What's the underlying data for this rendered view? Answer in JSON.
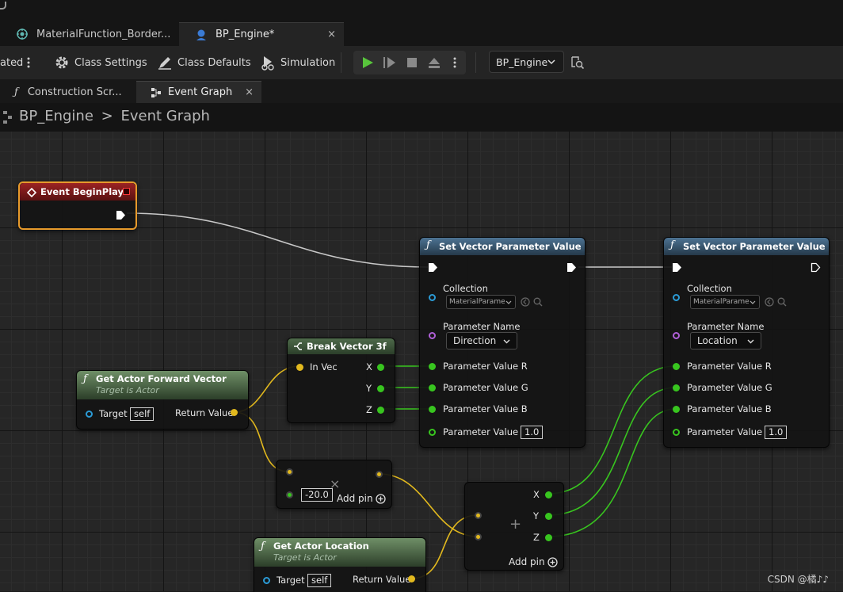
{
  "doc_tabs": [
    {
      "label": "MaterialFunction_Border..."
    },
    {
      "label": "BP_Engine*",
      "close": "×"
    }
  ],
  "toolbar": {
    "cut_text": "ated",
    "class_settings": "Class Settings",
    "class_defaults": "Class Defaults",
    "simulation": "Simulation",
    "blueprint_select": "BP_Engine"
  },
  "graph_tabs": [
    {
      "label": "Construction Scr..."
    },
    {
      "label": "Event Graph",
      "close": "×"
    }
  ],
  "breadcrumb": {
    "root": "BP_Engine",
    "sep": ">",
    "current": "Event Graph"
  },
  "nodes": {
    "event_begin_play": {
      "title": "Event BeginPlay"
    },
    "set_vec_1": {
      "title": "Set Vector Parameter Value",
      "collection_label": "Collection",
      "collection_value": "MaterialParame",
      "param_name_label": "Parameter Name",
      "param_name_value": "Direction",
      "r": "Parameter Value R",
      "g": "Parameter Value G",
      "b": "Parameter Value B",
      "a": "Parameter Value A",
      "a_value": "1.0"
    },
    "set_vec_2": {
      "title": "Set Vector Parameter Value",
      "collection_label": "Collection",
      "collection_value": "MaterialParame",
      "param_name_label": "Parameter Name",
      "param_name_value": "Location",
      "r": "Parameter Value R",
      "g": "Parameter Value G",
      "b": "Parameter Value B",
      "a": "Parameter Value A",
      "a_value": "1.0"
    },
    "break_vector": {
      "title": "Break Vector 3f",
      "in": "In Vec",
      "x": "X",
      "y": "Y",
      "z": "Z"
    },
    "get_forward": {
      "title": "Get Actor Forward Vector",
      "subtitle": "Target is Actor",
      "target": "Target",
      "target_value": "self",
      "return": "Return Value"
    },
    "multiply": {
      "symbol": "×",
      "value": "-20.0",
      "add_pin": "Add pin"
    },
    "add": {
      "symbol": "+",
      "x": "X",
      "y": "Y",
      "z": "Z",
      "add_pin": "Add pin"
    },
    "get_location": {
      "title": "Get Actor Location",
      "subtitle": "Target is Actor",
      "target": "Target",
      "target_value": "self",
      "return": "Return Value"
    }
  },
  "watermark": "CSDN @橘♪♪",
  "colors": {
    "exec_wire": "#c8c8c8",
    "vector_wire": "#e2b91e",
    "float_wire": "#38c51f",
    "event_header": "#8a1c1c",
    "function_header": "#3d5f7a",
    "pure_header": "#3e5b3c",
    "play_green": "#58c43c"
  }
}
